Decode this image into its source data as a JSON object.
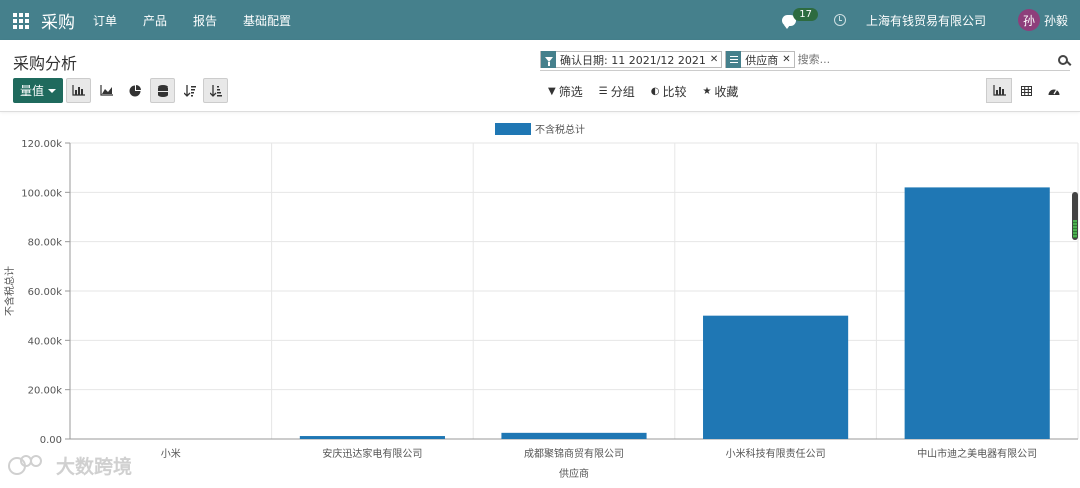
{
  "navbar": {
    "brand": "采购",
    "menu": [
      "订单",
      "产品",
      "报告",
      "基础配置"
    ],
    "chat_count": "17",
    "company": "上海有钱贸易有限公司",
    "avatar_initial": "孙",
    "username": "孙毅"
  },
  "control": {
    "breadcrumb": "采购分析",
    "facets": [
      {
        "icon": "filter-icon",
        "value": "确认日期: 11 2021/12 2021"
      },
      {
        "icon": "group-by-icon",
        "value": "供应商"
      }
    ],
    "search_placeholder": "搜索...",
    "measure_label": "量值",
    "filters": [
      {
        "icon": "funnel-icon",
        "label": "筛选"
      },
      {
        "icon": "list-icon",
        "label": "分组"
      },
      {
        "icon": "half-circle-icon",
        "label": "比较"
      },
      {
        "icon": "star-icon",
        "label": "收藏"
      }
    ]
  },
  "chart_data": {
    "type": "bar",
    "title": "",
    "legend": [
      "不含税总计"
    ],
    "legend_position": "top-center",
    "xlabel": "供应商",
    "ylabel": "不含税总计",
    "categories": [
      "小米",
      "安庆迅达家电有限公司",
      "成都聚锦商贸有限公司",
      "小米科技有限责任公司",
      "中山市迪之美电器有限公司"
    ],
    "series": [
      {
        "name": "不含税总计",
        "values": [
          0,
          1200,
          2500,
          50000,
          102000
        ],
        "color": "#1f77b4"
      }
    ],
    "ylim": [
      0,
      120000
    ],
    "yticks": [
      "0.00",
      "20.00k",
      "40.00k",
      "60.00k",
      "80.00k",
      "100.00k",
      "120.00k"
    ],
    "grid": true
  },
  "watermark": "大数跨境",
  "colors": {
    "navbar": "#45808c",
    "primary_button": "#1f6a5d",
    "bar": "#1f77b4",
    "avatar": "#8e3e7b",
    "badge": "#2d6b3f"
  }
}
